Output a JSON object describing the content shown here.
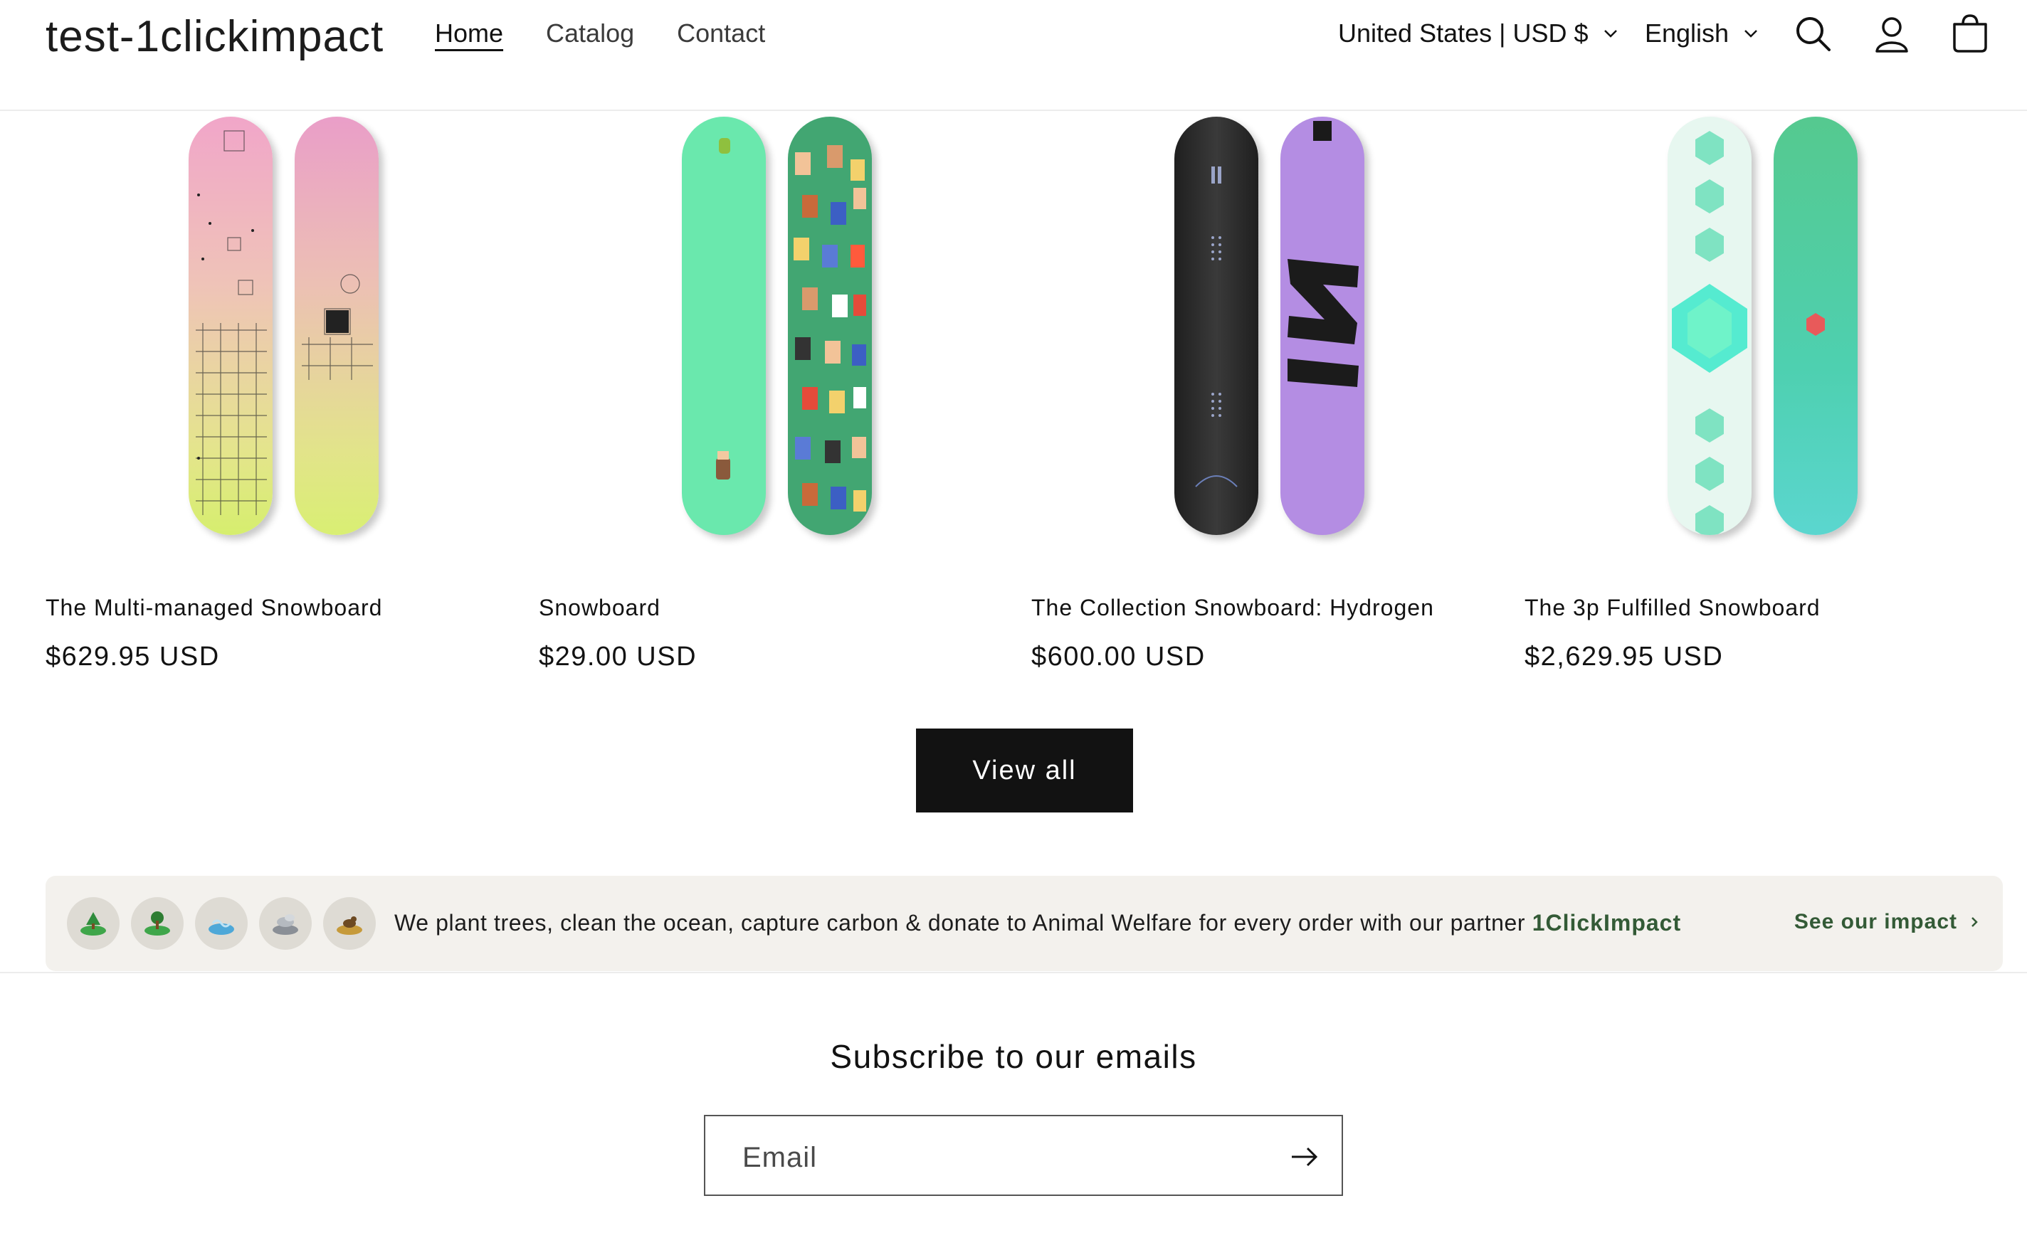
{
  "header": {
    "logo": "test-1clickimpact",
    "nav": [
      {
        "label": "Home",
        "active": true
      },
      {
        "label": "Catalog",
        "active": false
      },
      {
        "label": "Contact",
        "active": false
      }
    ],
    "country": "United States | USD $",
    "language": "English",
    "icons": [
      "search-icon",
      "account-icon",
      "cart-icon"
    ]
  },
  "products": [
    {
      "title": "The Multi-managed Snowboard",
      "price": "$629.95 USD"
    },
    {
      "title": "Snowboard",
      "price": "$29.00 USD"
    },
    {
      "title": "The Collection Snowboard: Hydrogen",
      "price": "$600.00 USD"
    },
    {
      "title": "The 3p Fulfilled Snowboard",
      "price": "$2,629.95 USD"
    }
  ],
  "view_all": "View all",
  "impact": {
    "text": "We plant trees, clean the ocean, capture carbon & donate to Animal Welfare for every order with our partner ",
    "partner": "1ClickImpact",
    "link": "See our impact",
    "badges": [
      "tree-icon",
      "tree-planting-icon",
      "ocean-icon",
      "carbon-icon",
      "animal-welfare-icon"
    ]
  },
  "newsletter": {
    "heading": "Subscribe to our emails",
    "placeholder": "Email"
  },
  "colors": {
    "accent_green": "#335a36",
    "button_dark": "#121212",
    "banner_bg": "#f3f1ed"
  }
}
